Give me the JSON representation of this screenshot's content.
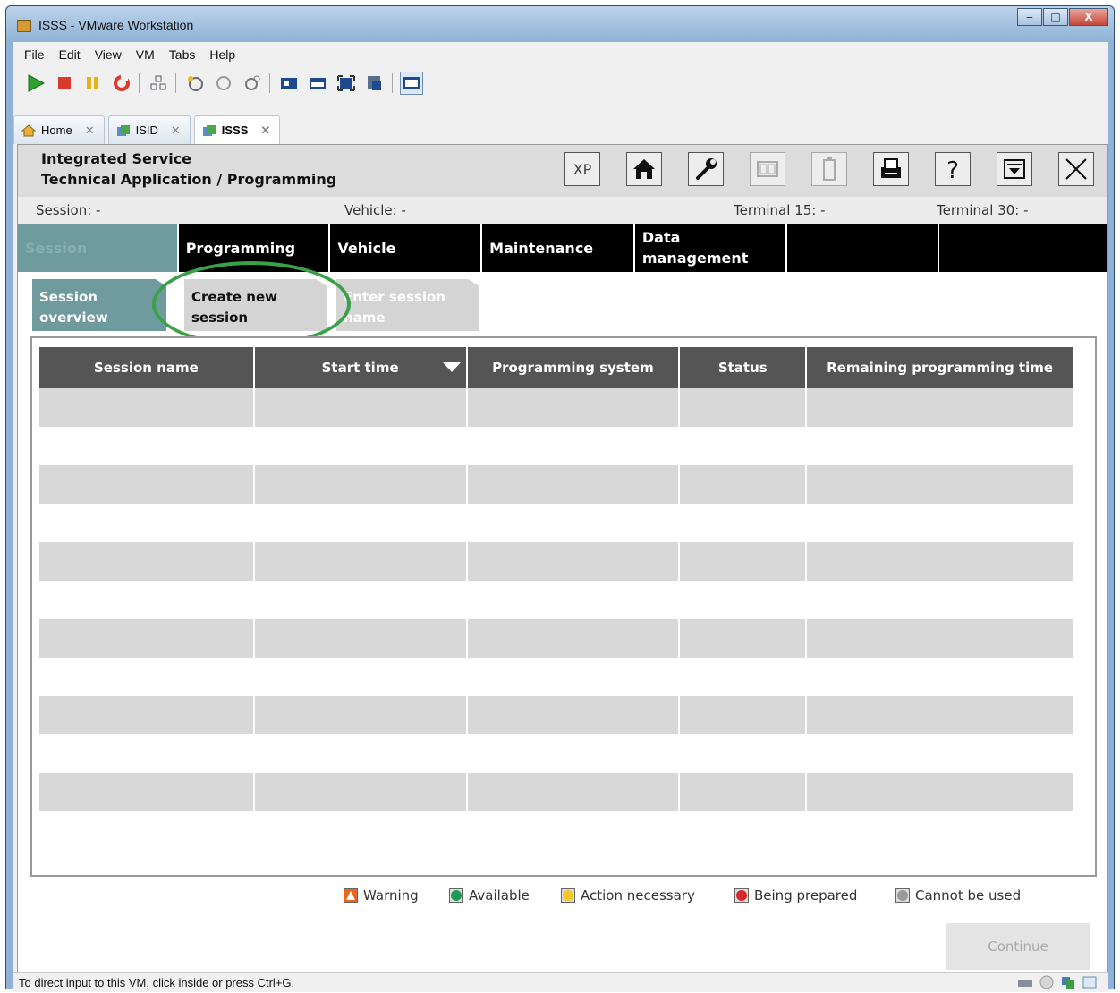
{
  "window": {
    "title": "ISSS - VMware Workstation",
    "buttons": [
      "‒",
      "□",
      "X"
    ]
  },
  "menu": [
    "File",
    "Edit",
    "View",
    "VM",
    "Tabs",
    "Help"
  ],
  "toolbar_icons": [
    "play-icon",
    "stop-icon",
    "pause-icon",
    "reset-icon",
    "network-icon",
    "snapshot-icon",
    "revert-icon",
    "snapshot-manager-icon",
    "console-view-icon",
    "quick-switch-icon",
    "full-screen-icon",
    "unity-icon",
    "view-icon"
  ],
  "vm_tabs": [
    {
      "label": "Home"
    },
    {
      "label": "ISID"
    },
    {
      "label": "ISSS"
    }
  ],
  "app": {
    "title_line1": "Integrated Service",
    "title_line2": "Technical Application / Programming",
    "header_buttons": {
      "xp": "XP"
    },
    "info": {
      "session": "Session:  -",
      "vehicle": "Vehicle:  -",
      "terminal15": "Terminal 15:  -",
      "terminal30": "Terminal 30:  -"
    },
    "nav": [
      "Session",
      "Programming",
      "Vehicle",
      "Maintenance",
      "Data management",
      "",
      ""
    ],
    "subtabs": [
      "Session overview",
      "Create new session",
      "Enter session name"
    ],
    "table": {
      "headers": [
        "Session name",
        "Start time",
        "Programming system",
        "Status",
        "Remaining programming time"
      ]
    },
    "legend": [
      "Warning",
      "Available",
      "Action necessary",
      "Being prepared",
      "Cannot be used"
    ],
    "legend_colors": [
      "#e8661f",
      "#1f9a55",
      "#f4c62a",
      "#d8262b",
      "#9a9a9a"
    ],
    "continue": "Continue"
  },
  "status": {
    "text": "To direct input to this VM, click inside or press Ctrl+G."
  }
}
